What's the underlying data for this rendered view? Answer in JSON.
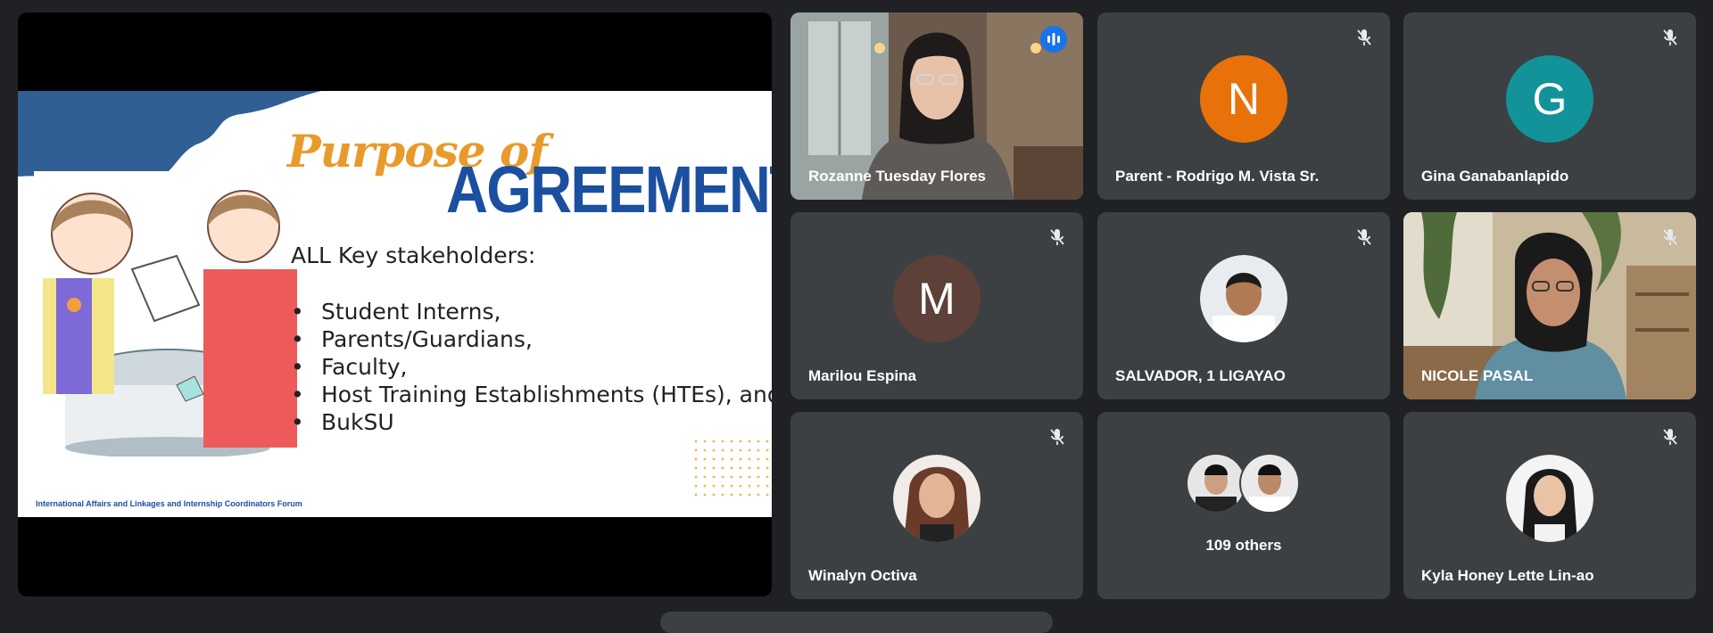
{
  "slide": {
    "title_script": "Purpose of",
    "title_main": "AGREEMENT",
    "subtitle": "ALL Key stakeholders:",
    "bullet": "•",
    "items": [
      "Student Interns,",
      "Parents/Guardians,",
      "Faculty,",
      "Host Training Establishments (HTEs), and",
      "BukSU"
    ],
    "footer": "International Affairs and Linkages and Internship Coordinators Forum"
  },
  "participants": [
    {
      "name": "Rozanne Tuesday Flores",
      "video": true,
      "speaking": true
    },
    {
      "name": "Parent - Rodrigo M. Vista Sr.",
      "initial": "N",
      "color": "#e8710a",
      "muted": true
    },
    {
      "name": "Gina Ganabanlapido",
      "initial": "G",
      "color": "#12939a",
      "muted": true
    },
    {
      "name": "Marilou Espina",
      "initial": "M",
      "color": "#5d4037",
      "muted": true
    },
    {
      "name": "SALVADOR, 1 LIGAYAO",
      "photo": true,
      "muted": true
    },
    {
      "name": "NICOLE PASAL",
      "video": true,
      "muted": true
    },
    {
      "name": "Winalyn Octiva",
      "photo": true,
      "muted": true
    },
    {
      "name": "Kyla Honey Lette Lin-ao",
      "photo": true,
      "muted": true
    }
  ],
  "others": {
    "label": "109 others"
  },
  "colors": {
    "background": "#202124",
    "tile": "#3c4043",
    "active_border": "#8ab4f8",
    "speaking": "#1a73e8"
  }
}
